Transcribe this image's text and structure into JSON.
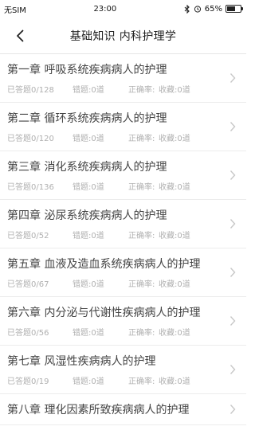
{
  "status": {
    "carrier": "无SIM",
    "time": "23:00",
    "battery_pct": "65%",
    "battery_level": 0.65
  },
  "nav": {
    "title": "基础知识 内科护理学"
  },
  "chapters": [
    {
      "title": "第一章 呼吸系统疾病病人的护理",
      "answered": "已答题0/128",
      "wrong": "错题:0道",
      "accuracy": "正确率:",
      "favorites": "收藏:0道"
    },
    {
      "title": "第二章 循环系统疾病病人的护理",
      "answered": "已答题0/120",
      "wrong": "错题:0道",
      "accuracy": "正确率:",
      "favorites": "收藏:0道"
    },
    {
      "title": "第三章 消化系统疾病病人的护理",
      "answered": "已答题0/136",
      "wrong": "错题:0道",
      "accuracy": "正确率:",
      "favorites": "收藏:0道"
    },
    {
      "title": "第四章 泌尿系统疾病病人的护理",
      "answered": "已答题0/52",
      "wrong": "错题:0道",
      "accuracy": "正确率:",
      "favorites": "收藏:0道"
    },
    {
      "title": "第五章 血液及造血系统疾病病人的护理",
      "answered": "已答题0/67",
      "wrong": "错题:0道",
      "accuracy": "正确率:",
      "favorites": "收藏:0道"
    },
    {
      "title": "第六章 内分泌与代谢性疾病病人的护理",
      "answered": "已答题0/56",
      "wrong": "错题:0道",
      "accuracy": "正确率:",
      "favorites": "收藏:0道"
    },
    {
      "title": "第七章 风湿性疾病病人的护理",
      "answered": "已答题0/19",
      "wrong": "错题:0道",
      "accuracy": "正确率:",
      "favorites": "收藏:0道"
    },
    {
      "title": "第八章 理化因素所致疾病病人的护理",
      "answered": "",
      "wrong": "",
      "accuracy": "",
      "favorites": ""
    }
  ],
  "icons": {
    "back": "chevron-left-icon",
    "row_arrow": "chevron-right-icon",
    "bluetooth": "bluetooth-icon",
    "alarm": "alarm-icon",
    "battery": "battery-icon"
  }
}
